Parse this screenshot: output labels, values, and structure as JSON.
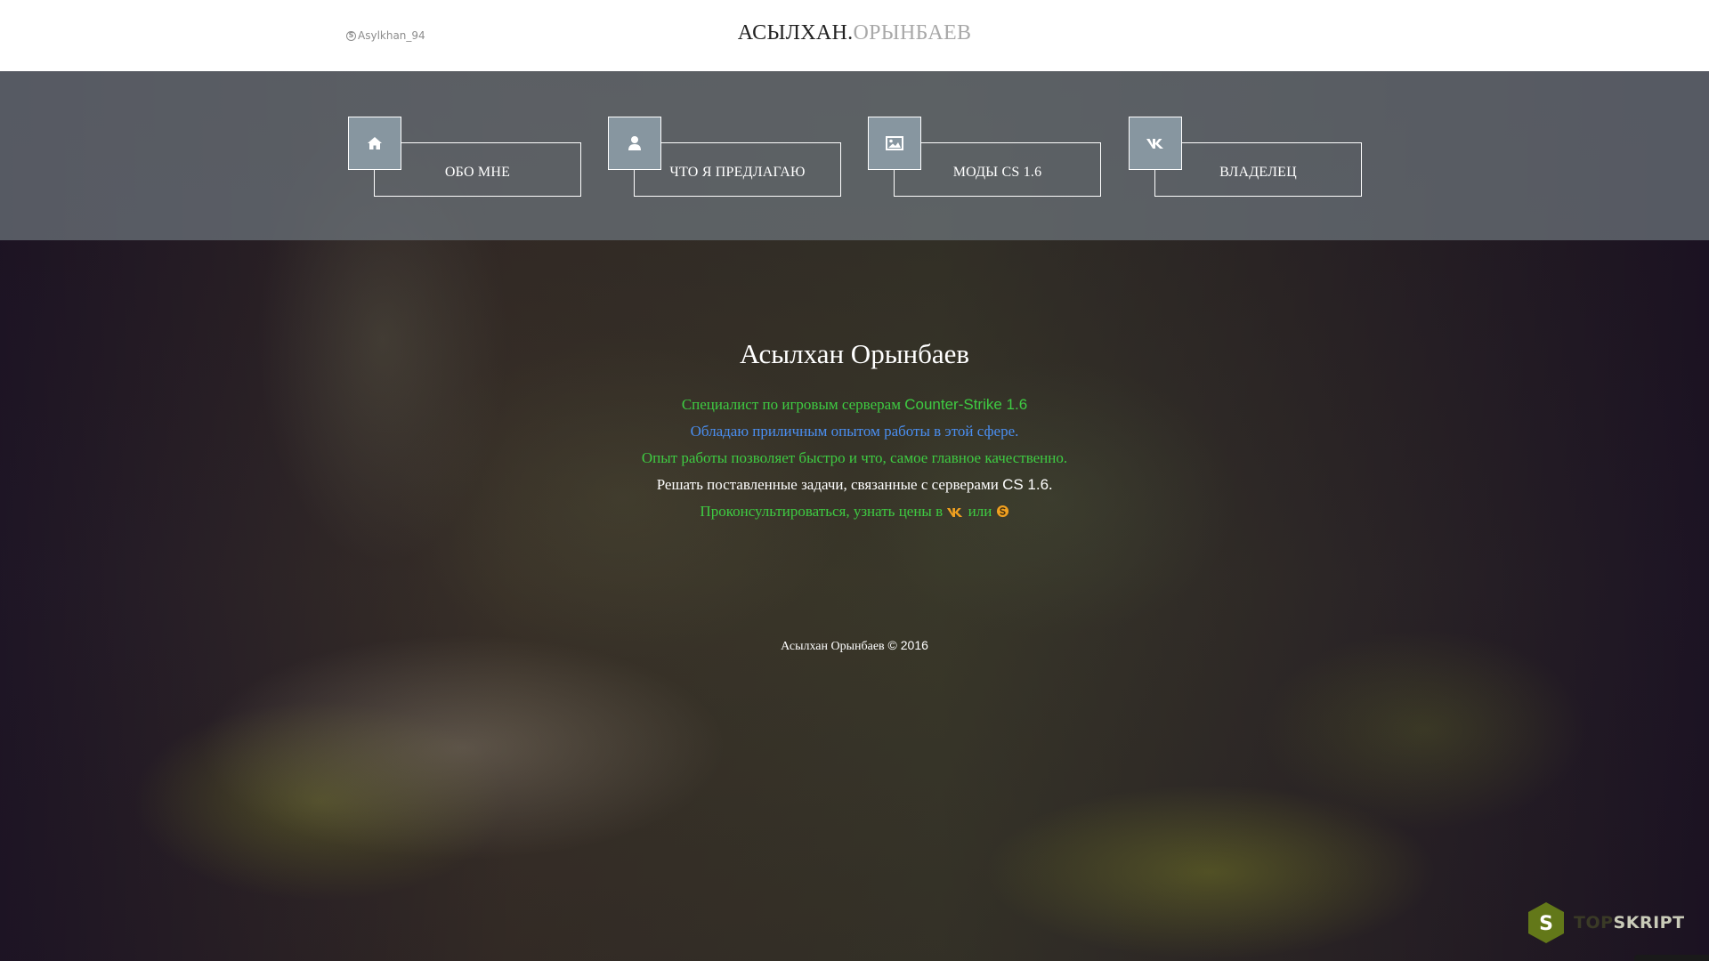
{
  "header": {
    "skype_username": "Asylkhan_94",
    "brand_first": "АСЫЛХАН",
    "brand_dot": ".",
    "brand_last": "ОРЫНБАЕВ"
  },
  "nav": {
    "items": [
      {
        "label": "ОБО МНЕ",
        "icon": "home-icon"
      },
      {
        "label": "ЧТО Я ПРЕДЛАГАЮ",
        "icon": "user-icon"
      },
      {
        "label": "МОДЫ CS 1.6",
        "icon": "image-icon"
      },
      {
        "label": "ВЛАДЕЛЕЦ",
        "icon": "vk-icon"
      }
    ]
  },
  "main": {
    "title": "Асылхан Орынбаев",
    "line1_text": "Специалист по игровым серверам ",
    "line1_game": "Counter-Strike 1.6",
    "line2": "Обладаю приличным опытом работы в этой сфере.",
    "line3": "Опыт работы позволяет быстро и что, самое главное качественно.",
    "line4_text": "Решать поставленные задачи, связанные с серверами ",
    "line4_game": "CS 1.6",
    "line4_end": ".",
    "line5_text": "Проконсультироваться, узнать цены в ",
    "line5_or": " или "
  },
  "footer": {
    "author": "Асылхан Орынбаев",
    "copyright": " © 2016"
  },
  "watermark": {
    "part1": "TOP",
    "part2": "SKRIPT",
    "logo_letter": "S"
  },
  "colors": {
    "accent_green": "#3ecb42",
    "accent_blue": "#4a8ef0",
    "vk_orange": "#f0a020",
    "icon_box": "#8796a0"
  }
}
